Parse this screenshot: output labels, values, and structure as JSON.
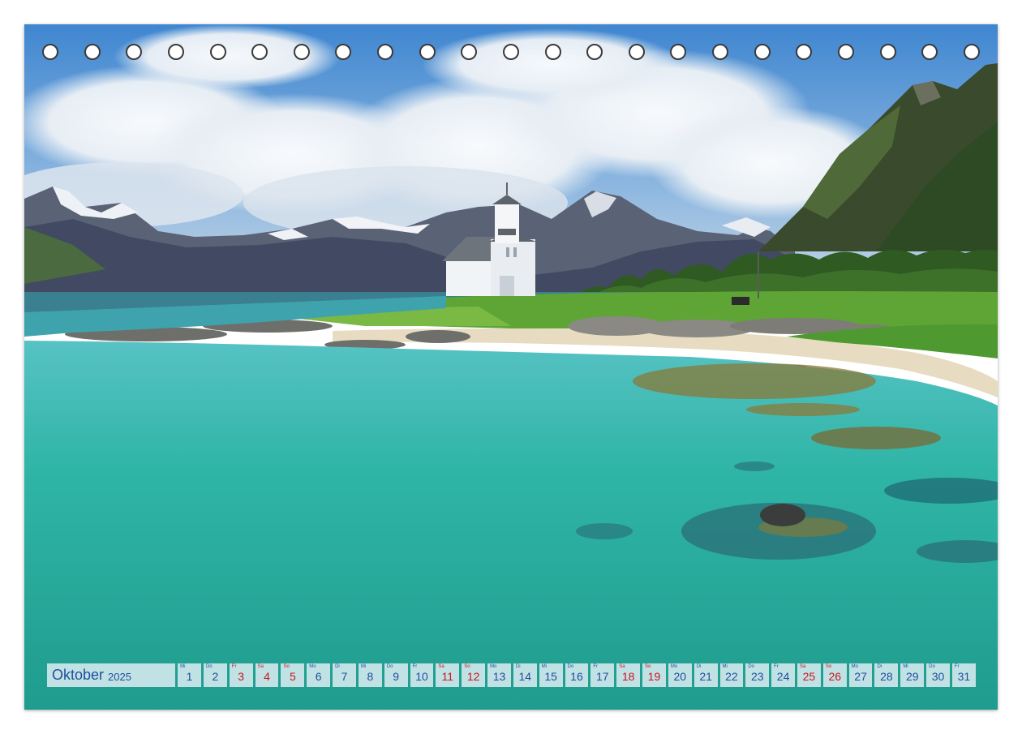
{
  "calendar": {
    "month": "Oktober",
    "year": "2025",
    "days": [
      {
        "n": "1",
        "wd": "Mi",
        "weekend": false
      },
      {
        "n": "2",
        "wd": "Do",
        "weekend": false
      },
      {
        "n": "3",
        "wd": "Fr",
        "weekend": true
      },
      {
        "n": "4",
        "wd": "Sa",
        "weekend": true
      },
      {
        "n": "5",
        "wd": "So",
        "weekend": true
      },
      {
        "n": "6",
        "wd": "Mo",
        "weekend": false
      },
      {
        "n": "7",
        "wd": "Di",
        "weekend": false
      },
      {
        "n": "8",
        "wd": "Mi",
        "weekend": false
      },
      {
        "n": "9",
        "wd": "Do",
        "weekend": false
      },
      {
        "n": "10",
        "wd": "Fr",
        "weekend": false
      },
      {
        "n": "11",
        "wd": "Sa",
        "weekend": true
      },
      {
        "n": "12",
        "wd": "So",
        "weekend": true
      },
      {
        "n": "13",
        "wd": "Mo",
        "weekend": false
      },
      {
        "n": "14",
        "wd": "Di",
        "weekend": false
      },
      {
        "n": "15",
        "wd": "Mi",
        "weekend": false
      },
      {
        "n": "16",
        "wd": "Do",
        "weekend": false
      },
      {
        "n": "17",
        "wd": "Fr",
        "weekend": false
      },
      {
        "n": "18",
        "wd": "Sa",
        "weekend": true
      },
      {
        "n": "19",
        "wd": "So",
        "weekend": true
      },
      {
        "n": "20",
        "wd": "Mo",
        "weekend": false
      },
      {
        "n": "21",
        "wd": "Di",
        "weekend": false
      },
      {
        "n": "22",
        "wd": "Mi",
        "weekend": false
      },
      {
        "n": "23",
        "wd": "Do",
        "weekend": false
      },
      {
        "n": "24",
        "wd": "Fr",
        "weekend": false
      },
      {
        "n": "25",
        "wd": "Sa",
        "weekend": true
      },
      {
        "n": "26",
        "wd": "So",
        "weekend": true
      },
      {
        "n": "27",
        "wd": "Mo",
        "weekend": false
      },
      {
        "n": "28",
        "wd": "Di",
        "weekend": false
      },
      {
        "n": "29",
        "wd": "Mi",
        "weekend": false
      },
      {
        "n": "30",
        "wd": "Do",
        "weekend": false
      },
      {
        "n": "31",
        "wd": "Fr",
        "weekend": false
      }
    ]
  },
  "binding_hole_count": 23,
  "colors": {
    "calendar_text": "#1e4f9c",
    "weekend_text": "#c8161e",
    "water": "#2fb5a6",
    "sky": "#5b9bd5"
  }
}
